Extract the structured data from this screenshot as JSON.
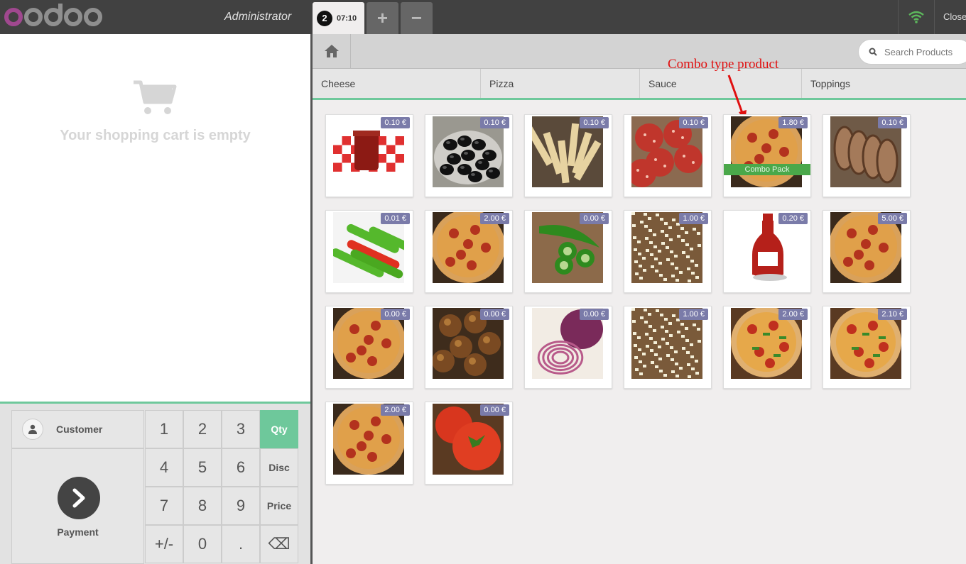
{
  "topbar": {
    "user": "Administrator",
    "order_number": "2",
    "order_time": "07:10",
    "add_label": "+",
    "remove_label": "−",
    "close_label": "Close"
  },
  "cart": {
    "empty_text": "Your shopping cart is empty"
  },
  "controls": {
    "customer_label": "Customer",
    "payment_label": "Payment",
    "keys": [
      "1",
      "2",
      "3",
      "Qty",
      "4",
      "5",
      "6",
      "Disc",
      "7",
      "8",
      "9",
      "Price",
      "+/-",
      "0",
      ".",
      "⌫"
    ]
  },
  "search": {
    "placeholder": "Search Products"
  },
  "categories": [
    "Cheese",
    "Pizza",
    "Sauce",
    "Toppings"
  ],
  "annotation": "Combo type product",
  "combo_label": "Combo Pack",
  "products": [
    {
      "price": "0.10 €",
      "icon": "jam-jar"
    },
    {
      "price": "0.10 €",
      "icon": "black-olives"
    },
    {
      "price": "0.10 €",
      "icon": "fries"
    },
    {
      "price": "0.10 €",
      "icon": "salami"
    },
    {
      "price": "1.80 €",
      "icon": "pizza-combo",
      "combo": true
    },
    {
      "price": "0.10 €",
      "icon": "sausage"
    },
    {
      "price": "0.01 €",
      "icon": "peppers"
    },
    {
      "price": "2.00 €",
      "icon": "pizza"
    },
    {
      "price": "0.00 €",
      "icon": "jalapeno"
    },
    {
      "price": "1.00 €",
      "icon": "grated-cheese"
    },
    {
      "price": "0.20 €",
      "icon": "ketchup-bottle"
    },
    {
      "price": "5.00 €",
      "icon": "pizza"
    },
    {
      "price": "0.00 €",
      "icon": "pizza"
    },
    {
      "price": "0.00 €",
      "icon": "meatballs"
    },
    {
      "price": "0.00 €",
      "icon": "onions"
    },
    {
      "price": "1.00 €",
      "icon": "grated-cheese"
    },
    {
      "price": "2.00 €",
      "icon": "pizza-green"
    },
    {
      "price": "2.10 €",
      "icon": "pizza-green"
    },
    {
      "price": "2.00 €",
      "icon": "pizza"
    },
    {
      "price": "0.00 €",
      "icon": "tomatoes"
    }
  ],
  "colors": {
    "accent": "#6ec89b",
    "price_badge": "#7a7ba9",
    "topbar": "#414141",
    "annotation": "#e01010"
  }
}
